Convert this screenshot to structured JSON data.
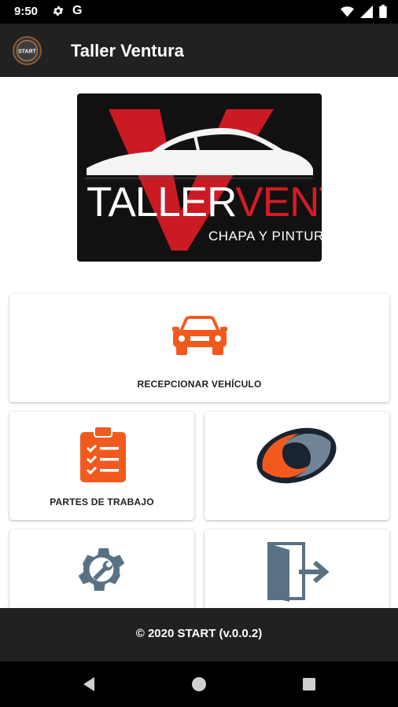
{
  "status_bar": {
    "time": "9:50",
    "g_letter": "G",
    "icons": [
      "gear-icon",
      "google-icon",
      "wifi-icon",
      "signal-icon",
      "battery-icon"
    ]
  },
  "app_bar": {
    "title": "Taller Ventura",
    "logo_text": "START"
  },
  "brand_logo": {
    "word1": "TALLER",
    "word2": "VENTURA",
    "tagline": "CHAPA Y PINTURA",
    "colors": {
      "red": "#d51b26",
      "background": "#111111"
    }
  },
  "tiles": [
    {
      "label": "RECEPCIONAR VEHÍCULO",
      "icon": "car-icon",
      "color": "#f25a1d"
    },
    {
      "label": "PARTES DE TRABAJO",
      "icon": "clipboard-checklist-icon",
      "color": "#f25a1d"
    },
    {
      "label": "",
      "icon": "swirl-logo-icon",
      "color": "#f25a1d"
    },
    {
      "label": "",
      "icon": "wrench-gear-icon",
      "color": "#5a7184"
    },
    {
      "label": "",
      "icon": "exit-door-icon",
      "color": "#5a7184"
    }
  ],
  "footer": {
    "text": "© 2020 START (v.0.0.2)"
  },
  "nav_bar": {
    "icons": [
      "back-icon",
      "home-icon",
      "recents-icon"
    ]
  },
  "theme": {
    "accent_orange": "#f25a1d",
    "slate_blue": "#5a7184",
    "bar_dark": "#212121"
  }
}
